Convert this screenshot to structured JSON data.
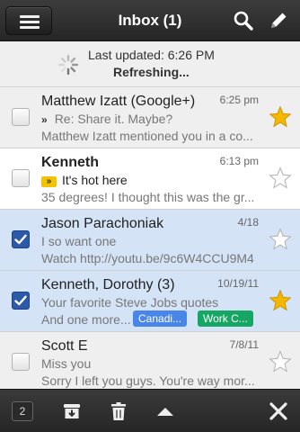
{
  "app": {
    "title": "Inbox (1)",
    "accent": "#2c5aa9"
  },
  "toolbar": {
    "menu_icon": "hamburger-menu-icon",
    "search_icon": "search-icon",
    "compose_icon": "pencil-compose-icon"
  },
  "status": {
    "last_updated": "Last updated: 6:26 PM",
    "refreshing": "Refreshing..."
  },
  "emails": [
    {
      "sender": "Matthew Izatt (Google+)",
      "date": "6:25 pm",
      "subject": "Re: Share it. Maybe?",
      "snippet": "Matthew Izatt mentioned you in a co...",
      "importance": "plain",
      "importance_mark": "»",
      "unread": false,
      "selected": false,
      "starred": true,
      "labels": []
    },
    {
      "sender": "Kenneth",
      "date": "6:13 pm",
      "subject": "It's hot here",
      "snippet": "35 degrees! I thought this was the gr...",
      "importance": "box",
      "importance_mark": "»",
      "unread": true,
      "selected": false,
      "starred": false,
      "labels": []
    },
    {
      "sender": "Jason Parachoniak",
      "date": "4/18",
      "subject": "I so want one",
      "snippet": "Watch http://youtu.be/9c6W4CCU9M4",
      "unread": false,
      "selected": true,
      "starred": false,
      "labels": []
    },
    {
      "sender": "Kenneth, Dorothy (3)",
      "date": "10/19/11",
      "subject": "Your favorite Steve Jobs quotes",
      "snippet": "And one more...",
      "unread": false,
      "selected": true,
      "starred": true,
      "labels": [
        {
          "text": "Canadi...",
          "color": "#4a86e8"
        },
        {
          "text": "Work C...",
          "color": "#16a765"
        }
      ]
    },
    {
      "sender": "Scott E",
      "date": "7/8/11",
      "subject": "Miss you",
      "snippet": "Sorry I left you guys. You're way mor...",
      "unread": false,
      "selected": false,
      "starred": false,
      "labels": []
    }
  ],
  "bottom": {
    "selected_count": "2",
    "archive_icon": "archive-icon",
    "trash_icon": "trash-icon",
    "up_icon": "up-arrow-icon",
    "close_icon": "close-icon"
  },
  "colors": {
    "star_on": "#f5b800",
    "star_off": "#ffffff",
    "selected_row": "#d5e3f7"
  }
}
